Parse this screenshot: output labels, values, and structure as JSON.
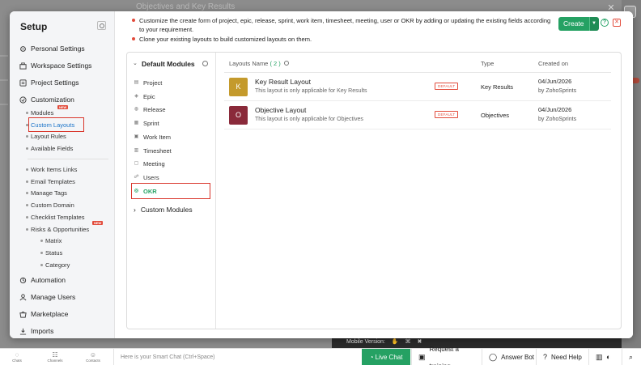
{
  "background": {
    "title": "Objectives and Key Results",
    "mobile_version_label": "Mobile Version:"
  },
  "sidebar": {
    "title": "Setup",
    "items": [
      {
        "label": "Personal Settings",
        "icon": "gear-icon"
      },
      {
        "label": "Workspace Settings",
        "icon": "workspace-icon"
      },
      {
        "label": "Project Settings",
        "icon": "project-icon"
      },
      {
        "label": "Customization",
        "icon": "customization-icon"
      }
    ],
    "customization_subitems": [
      {
        "label": "Modules",
        "badge": "NEW"
      },
      {
        "label": "Custom Layouts",
        "active": true
      },
      {
        "label": "Layout Rules"
      },
      {
        "label": "Available Fields"
      }
    ],
    "more_subitems": [
      {
        "label": "Work Items Links"
      },
      {
        "label": "Email Templates"
      },
      {
        "label": "Manage Tags"
      },
      {
        "label": "Custom Domain"
      },
      {
        "label": "Checklist Templates",
        "badge": "NEW"
      },
      {
        "label": "Risks & Opportunities"
      }
    ],
    "risks_subitems": [
      {
        "label": "Matrix"
      },
      {
        "label": "Status"
      },
      {
        "label": "Category"
      }
    ],
    "bottom_items": [
      {
        "label": "Automation",
        "icon": "automation-icon"
      },
      {
        "label": "Manage Users",
        "icon": "users-icon"
      },
      {
        "label": "Marketplace",
        "icon": "marketplace-icon"
      },
      {
        "label": "Imports",
        "icon": "imports-icon"
      }
    ]
  },
  "info": {
    "lines": [
      "Customize the create form of project, epic, release, sprint, work item, timesheet, meeting, user or OKR by adding or updating the existing fields according to your requirement.",
      "Clone your existing layouts to build customized layouts on them."
    ]
  },
  "toolbar": {
    "create_label": "Create"
  },
  "modules": {
    "default_heading": "Default Modules",
    "items": [
      {
        "label": "Project",
        "icon": "project-icon"
      },
      {
        "label": "Epic",
        "icon": "epic-icon"
      },
      {
        "label": "Release",
        "icon": "release-icon"
      },
      {
        "label": "Sprint",
        "icon": "sprint-icon"
      },
      {
        "label": "Work Item",
        "icon": "work-item-icon"
      },
      {
        "label": "Timesheet",
        "icon": "timesheet-icon"
      },
      {
        "label": "Meeting",
        "icon": "meeting-icon"
      },
      {
        "label": "Users",
        "icon": "users-icon"
      },
      {
        "label": "OKR",
        "icon": "okr-icon",
        "active": true
      }
    ],
    "custom_heading": "Custom Modules"
  },
  "layouts_table": {
    "columns": {
      "name": "Layouts Name",
      "count": "( 2 )",
      "type": "Type",
      "created_on": "Created on"
    },
    "rows": [
      {
        "initial": "K",
        "color": "#c49a2c",
        "title": "Key Result Layout",
        "description": "This layout is only applicable for Key Results",
        "badge": "DEFAULT",
        "type": "Key Results",
        "date": "04/Jun/2026",
        "by": "by ZohoSprints"
      },
      {
        "initial": "O",
        "color": "#8a2a3a",
        "title": "Objective Layout",
        "description": "This layout is only applicable for Objectives",
        "badge": "DEFAULT",
        "type": "Objectives",
        "date": "04/Jun/2026",
        "by": "by ZohoSprints"
      }
    ]
  },
  "bottom_bar": {
    "left_icons": [
      {
        "label": "Chats",
        "icon": "chat-icon"
      },
      {
        "label": "Channels",
        "icon": "channels-icon"
      },
      {
        "label": "Contacts",
        "icon": "contacts-icon"
      }
    ],
    "chat_placeholder": "Here is your Smart Chat (Ctrl+Space)",
    "live_chat": "Live Chat",
    "request_training": "Request a training",
    "answer_bot": "Answer Bot",
    "need_help": "Need Help"
  }
}
